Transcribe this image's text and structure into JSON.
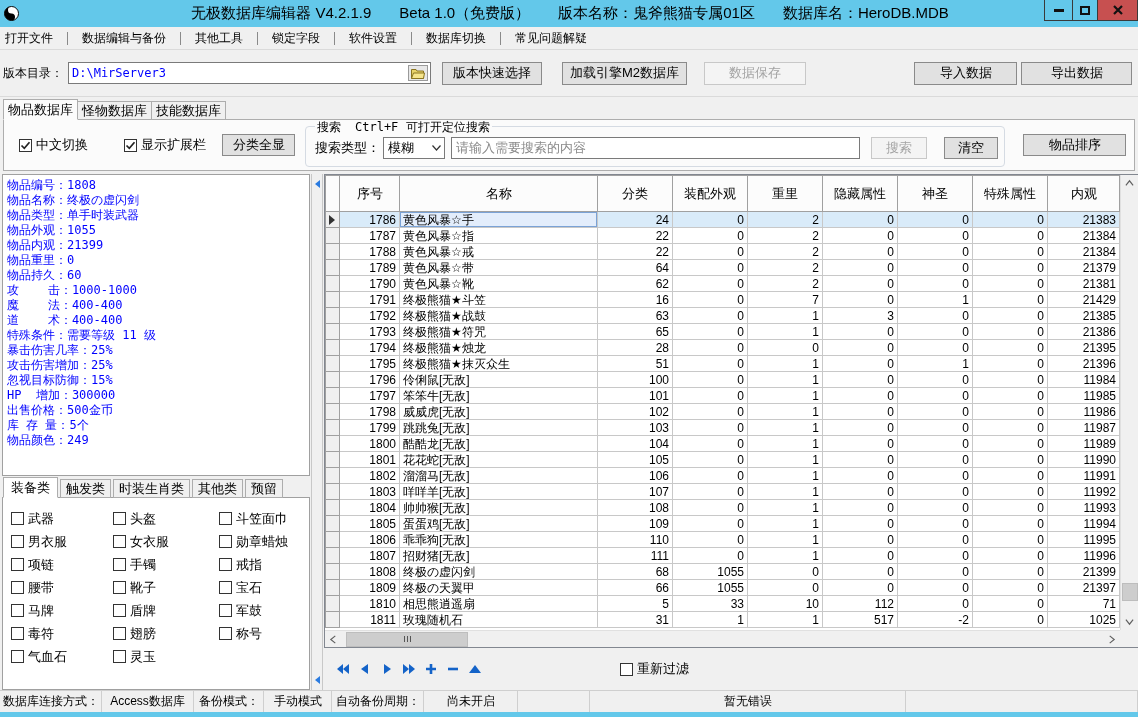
{
  "window": {
    "title": [
      "无极数据库编辑器 V4.2.1.9",
      "Beta 1.0（免费版）",
      "版本名称：鬼斧熊猫专属01区",
      "数据库名：HeroDB.MDB"
    ]
  },
  "menu": [
    "打开文件",
    "数据编辑与备份",
    "其他工具",
    "锁定字段",
    "软件设置",
    "数据库切换",
    "常见问题解疑"
  ],
  "toolbar": {
    "path_label": "版本目录：",
    "path_value": "D:\\MirServer3",
    "buttons": [
      {
        "label": "版本快速选择",
        "disabled": false
      },
      {
        "label": "加载引擎M2数据库",
        "disabled": false
      },
      {
        "label": "数据保存",
        "disabled": true
      }
    ],
    "data_buttons": [
      {
        "label": "导入数据",
        "disabled": false
      },
      {
        "label": "导出数据",
        "disabled": false
      }
    ]
  },
  "tabs": [
    {
      "label": "物品数据库",
      "selected": true
    },
    {
      "label": "怪物数据库",
      "selected": false
    },
    {
      "label": "技能数据库",
      "selected": false
    }
  ],
  "options": {
    "checkboxes": [
      {
        "label": "中文切换",
        "checked": true
      },
      {
        "label": "显示扩展栏",
        "checked": true
      }
    ],
    "show_all_button": "分类全显"
  },
  "search": {
    "legend": "搜索",
    "hint": "Ctrl+F 可打开定位搜索",
    "type_label": "搜索类型：",
    "type_value": "模糊",
    "placeholder": "请输入需要搜索的内容",
    "search_button": {
      "label": "搜索",
      "disabled": true
    },
    "clear_button": {
      "label": "清空",
      "disabled": false
    }
  },
  "sort_button": "物品排序",
  "item_info": [
    "物品编号：1808",
    "物品名称：终极の虚闪剑",
    "物品类型：单手时装武器",
    "物品外观：1055",
    "物品内观：21399",
    "物品重里：0",
    "物品持久：60",
    "攻    击：1000-1000",
    "魔    法：400-400",
    "道    术：400-400",
    "特殊条件：需要等级 11 级",
    "暴击伤害几率：25%",
    "攻击伤害增加：25%",
    "忽视目标防御：15%",
    "HP  增加：300000",
    "出售价格：500金币",
    "库 存 量：5个",
    "物品颜色：249"
  ],
  "category_tabs": [
    {
      "label": "装备类",
      "selected": true
    },
    {
      "label": "触发类",
      "selected": false
    },
    {
      "label": "时装生肖类",
      "selected": false
    },
    {
      "label": "其他类",
      "selected": false
    },
    {
      "label": "预留",
      "selected": false
    }
  ],
  "categories": [
    {
      "label": "武器",
      "checked": false
    },
    {
      "label": "头盔",
      "checked": false
    },
    {
      "label": "斗笠面巾",
      "checked": false
    },
    {
      "label": "男衣服",
      "checked": false
    },
    {
      "label": "女衣服",
      "checked": false
    },
    {
      "label": "勋章蜡烛",
      "checked": false
    },
    {
      "label": "项链",
      "checked": false
    },
    {
      "label": "手镯",
      "checked": false
    },
    {
      "label": "戒指",
      "checked": false
    },
    {
      "label": "腰带",
      "checked": false
    },
    {
      "label": "靴子",
      "checked": false
    },
    {
      "label": "宝石",
      "checked": false
    },
    {
      "label": "马牌",
      "checked": false
    },
    {
      "label": "盾牌",
      "checked": false
    },
    {
      "label": "军鼓",
      "checked": false
    },
    {
      "label": "毒符",
      "checked": false
    },
    {
      "label": "翅膀",
      "checked": false
    },
    {
      "label": "称号",
      "checked": false
    },
    {
      "label": "气血石",
      "checked": false
    },
    {
      "label": "灵玉",
      "checked": false
    }
  ],
  "table": {
    "columns": [
      "序号",
      "名称",
      "分类",
      "装配外观",
      "重里",
      "隐藏属性",
      "神圣",
      "特殊属性",
      "内观"
    ],
    "rows": [
      {
        "selected": true,
        "cells": [
          "1786",
          "黄色风暴☆手",
          "24",
          "0",
          "2",
          "0",
          "0",
          "0",
          "21383"
        ]
      },
      {
        "selected": false,
        "cells": [
          "1787",
          "黄色风暴☆指",
          "22",
          "0",
          "2",
          "0",
          "0",
          "0",
          "21384"
        ]
      },
      {
        "selected": false,
        "cells": [
          "1788",
          "黄色风暴☆戒",
          "22",
          "0",
          "2",
          "0",
          "0",
          "0",
          "21384"
        ]
      },
      {
        "selected": false,
        "cells": [
          "1789",
          "黄色风暴☆带",
          "64",
          "0",
          "2",
          "0",
          "0",
          "0",
          "21379"
        ]
      },
      {
        "selected": false,
        "cells": [
          "1790",
          "黄色风暴☆靴",
          "62",
          "0",
          "2",
          "0",
          "0",
          "0",
          "21381"
        ]
      },
      {
        "selected": false,
        "cells": [
          "1791",
          "终极熊猫★斗笠",
          "16",
          "0",
          "7",
          "0",
          "1",
          "0",
          "21429"
        ]
      },
      {
        "selected": false,
        "cells": [
          "1792",
          "终极熊猫★战鼓",
          "63",
          "0",
          "1",
          "3",
          "0",
          "0",
          "21385"
        ]
      },
      {
        "selected": false,
        "cells": [
          "1793",
          "终极熊猫★符咒",
          "65",
          "0",
          "1",
          "0",
          "0",
          "0",
          "21386"
        ]
      },
      {
        "selected": false,
        "cells": [
          "1794",
          "终极熊猫★烛龙",
          "28",
          "0",
          "0",
          "0",
          "0",
          "0",
          "21395"
        ]
      },
      {
        "selected": false,
        "cells": [
          "1795",
          "终极熊猫★抹灭众生",
          "51",
          "0",
          "1",
          "0",
          "1",
          "0",
          "21396"
        ]
      },
      {
        "selected": false,
        "cells": [
          "1796",
          "伶俐鼠[无敌]",
          "100",
          "0",
          "1",
          "0",
          "0",
          "0",
          "11984"
        ]
      },
      {
        "selected": false,
        "cells": [
          "1797",
          "笨笨牛[无敌]",
          "101",
          "0",
          "1",
          "0",
          "0",
          "0",
          "11985"
        ]
      },
      {
        "selected": false,
        "cells": [
          "1798",
          "威威虎[无敌]",
          "102",
          "0",
          "1",
          "0",
          "0",
          "0",
          "11986"
        ]
      },
      {
        "selected": false,
        "cells": [
          "1799",
          "跳跳兔[无敌]",
          "103",
          "0",
          "1",
          "0",
          "0",
          "0",
          "11987"
        ]
      },
      {
        "selected": false,
        "cells": [
          "1800",
          "酷酷龙[无敌]",
          "104",
          "0",
          "1",
          "0",
          "0",
          "0",
          "11989"
        ]
      },
      {
        "selected": false,
        "cells": [
          "1801",
          "花花蛇[无敌]",
          "105",
          "0",
          "1",
          "0",
          "0",
          "0",
          "11990"
        ]
      },
      {
        "selected": false,
        "cells": [
          "1802",
          "溜溜马[无敌]",
          "106",
          "0",
          "1",
          "0",
          "0",
          "0",
          "11991"
        ]
      },
      {
        "selected": false,
        "cells": [
          "1803",
          "咩咩羊[无敌]",
          "107",
          "0",
          "1",
          "0",
          "0",
          "0",
          "11992"
        ]
      },
      {
        "selected": false,
        "cells": [
          "1804",
          "帅帅猴[无敌]",
          "108",
          "0",
          "1",
          "0",
          "0",
          "0",
          "11993"
        ]
      },
      {
        "selected": false,
        "cells": [
          "1805",
          "蛋蛋鸡[无敌]",
          "109",
          "0",
          "1",
          "0",
          "0",
          "0",
          "11994"
        ]
      },
      {
        "selected": false,
        "cells": [
          "1806",
          "乖乖狗[无敌]",
          "110",
          "0",
          "1",
          "0",
          "0",
          "0",
          "11995"
        ]
      },
      {
        "selected": false,
        "cells": [
          "1807",
          "招财猪[无敌]",
          "111",
          "0",
          "1",
          "0",
          "0",
          "0",
          "11996"
        ]
      },
      {
        "selected": false,
        "cells": [
          "1808",
          "终极の虚闪剑",
          "68",
          "1055",
          "0",
          "0",
          "0",
          "0",
          "21399"
        ]
      },
      {
        "selected": false,
        "cells": [
          "1809",
          "终极の天翼甲",
          "66",
          "1055",
          "0",
          "0",
          "0",
          "0",
          "21397"
        ]
      },
      {
        "selected": false,
        "cells": [
          "1810",
          "相思熊逍遥扇",
          "5",
          "33",
          "10",
          "112",
          "0",
          "0",
          "71"
        ]
      },
      {
        "selected": false,
        "cells": [
          "1811",
          "玫瑰随机石",
          "31",
          "1",
          "1",
          "517",
          "-2",
          "0",
          "1025"
        ]
      }
    ]
  },
  "navigator": {
    "filter": {
      "label": "重新过滤",
      "checked": false
    }
  },
  "status_bar": [
    "数据库连接方式：",
    "Access数据库",
    "备份模式：",
    "手动模式",
    "自动备份周期：",
    "尚未开启",
    "暂无错误"
  ]
}
